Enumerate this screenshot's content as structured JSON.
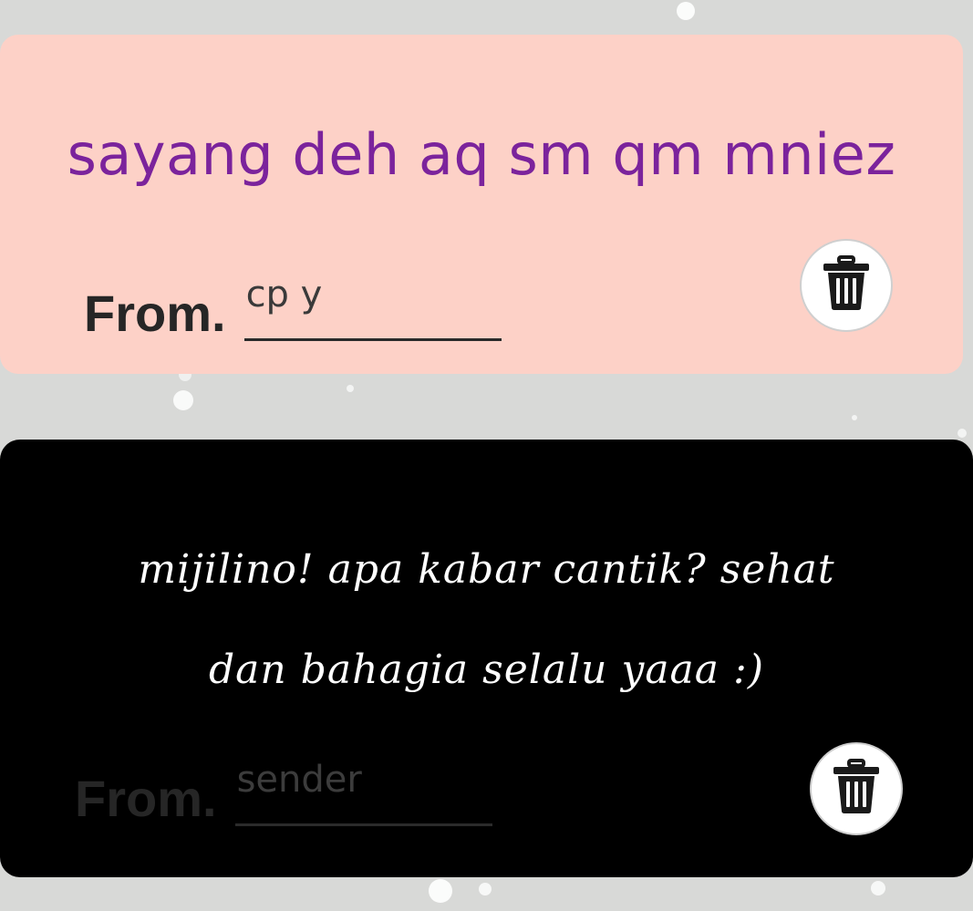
{
  "cards": [
    {
      "message": "sayang deh aq sm qm mniez",
      "from_label": "From.",
      "sender_value": "cp y",
      "delete_icon": "trash-icon",
      "background": "#fdd1c7",
      "message_color": "#7b239c"
    },
    {
      "message_line1": "mijilino! apa kabar cantik? sehat",
      "message_line2": "dan bahagia selalu yaaa :)",
      "from_label": "From.",
      "sender_placeholder": "sender",
      "delete_icon": "trash-icon",
      "background": "#000000",
      "message_color": "#ffffff"
    }
  ]
}
